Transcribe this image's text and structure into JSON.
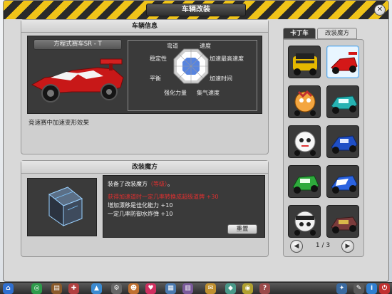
{
  "window": {
    "title": "车辆改装"
  },
  "vehicle_info": {
    "header": "车辆信息",
    "car_name": "方程式赛车SR - T",
    "effect_text": "竞速赛中加速变形效果",
    "stats": [
      {
        "label": "弯道"
      },
      {
        "label": "速度"
      },
      {
        "label": "加速最高速度"
      },
      {
        "label": "加速时间"
      },
      {
        "label": "集气速度"
      },
      {
        "label": "强化力量"
      },
      {
        "label": "平衡"
      },
      {
        "label": "稳定性"
      }
    ]
  },
  "mod_magic": {
    "header": "改装魔方",
    "equipped_prefix": "装备了改装魔方",
    "equipped_name": "（等级）",
    "equipped_suffix": "。",
    "effects": [
      {
        "text": "获得加速道时一定几率转换成超级道牌 +30",
        "color": "#e03030"
      },
      {
        "text": "增加漂移是佳化能力 +10",
        "color": "#f2f2f2"
      },
      {
        "text": "一定几率防御水炸弹 +10",
        "color": "#f2f2f2"
      }
    ],
    "reset_label": "重置"
  },
  "tabs": [
    {
      "label": "卡丁车",
      "active": true
    },
    {
      "label": "改装魔方",
      "active": false
    }
  ],
  "pager": {
    "text": "1 / 3",
    "prev": "◀",
    "next": "▶"
  },
  "colors": {
    "hazard_yellow": "#f0c419",
    "panel_dark": "#3a3a3a",
    "accent_blue": "#5aa9e6",
    "effect_red": "#e03030"
  },
  "taskbar": {
    "icons": [
      "home-icon",
      "globe-icon",
      "cart-icon",
      "tools-icon",
      "rocket-icon",
      "gear-icon",
      "person-icon",
      "heart-icon",
      "chart-icon",
      "book-icon",
      "mail-icon",
      "shop-icon",
      "bell-icon",
      "quest-icon",
      "settings-icon",
      "wrench-icon",
      "info-icon",
      "power-icon"
    ]
  }
}
